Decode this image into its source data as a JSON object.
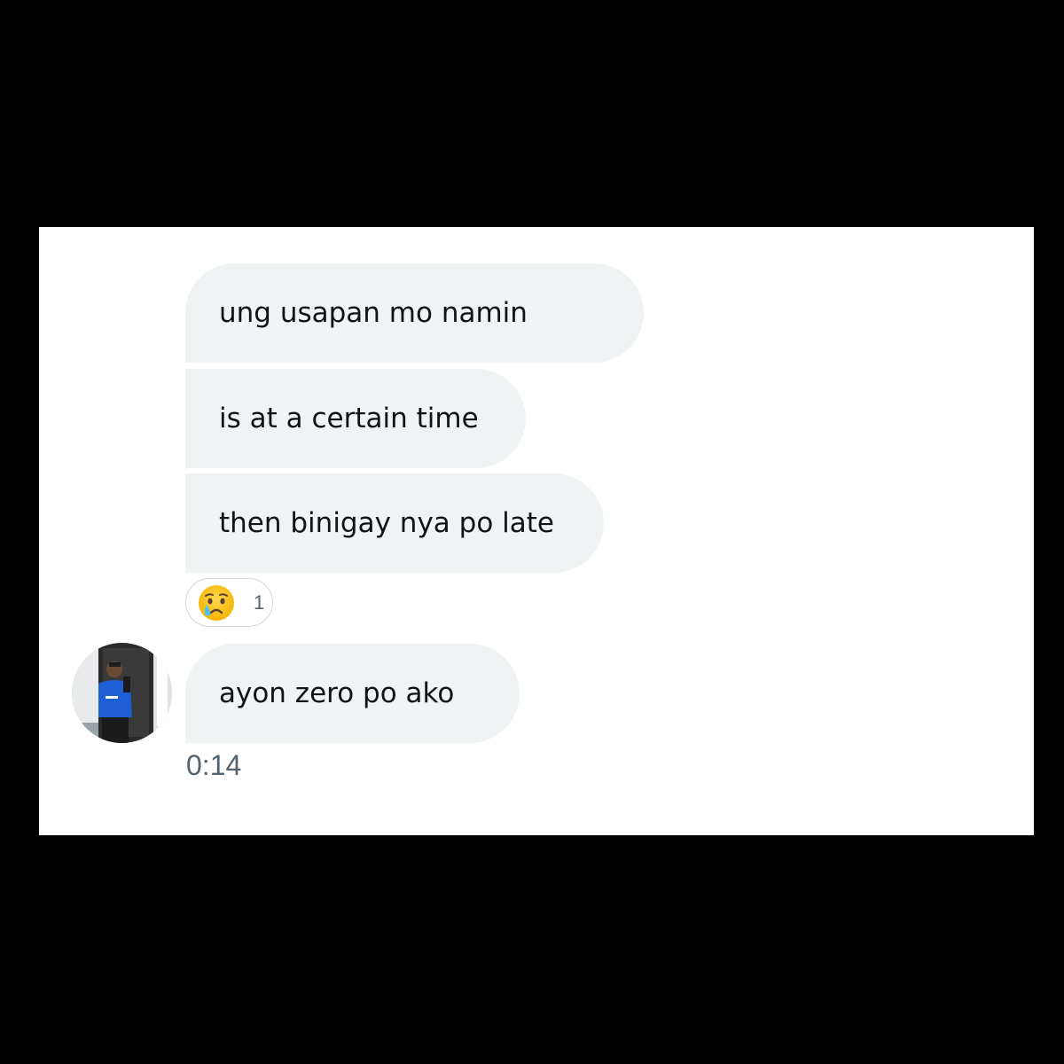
{
  "conversation": {
    "messages": [
      {
        "text": "ung usapan mo namin"
      },
      {
        "text": "is at a certain time"
      },
      {
        "text": "then binigay nya po late"
      },
      {
        "text": "ayon zero po ako"
      }
    ],
    "reaction": {
      "emoji": "crying-face-icon",
      "count": "1"
    },
    "timestamp": "0:14"
  },
  "colors": {
    "bubble": "#eff3f4",
    "text": "#0f1419",
    "muted": "#536471",
    "frame": "#ffffff",
    "background": "#000000"
  }
}
